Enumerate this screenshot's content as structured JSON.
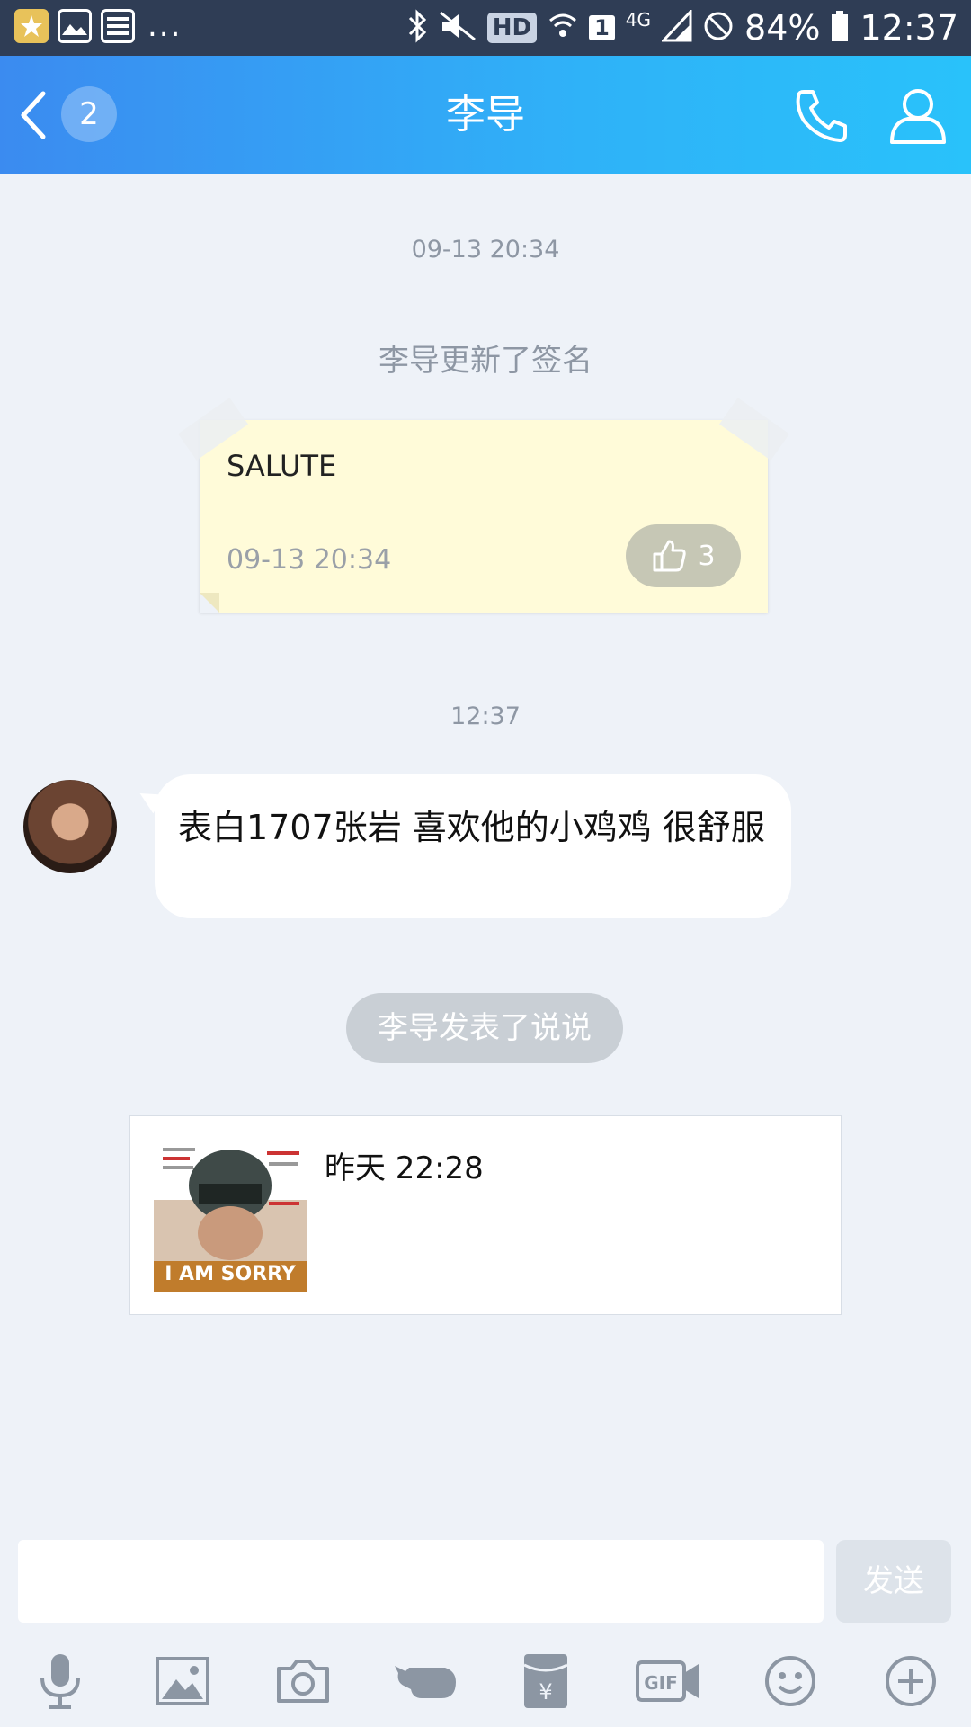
{
  "status_bar": {
    "dots": "...",
    "hd": "HD",
    "sim": "1",
    "network": "4G",
    "battery": "84%",
    "time": "12:37"
  },
  "header": {
    "title": "李导",
    "unread_count": "2",
    "gradient_start": "#3b8bf0",
    "gradient_end": "#29c2fa"
  },
  "chat": {
    "timestamp_1": "09-13 20:34",
    "signature_notice": "李导更新了签名",
    "signature_card": {
      "text": "SALUTE",
      "time": "09-13 20:34",
      "likes": "3"
    },
    "timestamp_2": "12:37",
    "message": {
      "text": "表白1707张岩 喜欢他的小鸡鸡 很舒服"
    },
    "post_notice": "李导发表了说说",
    "feed_card": {
      "time": "昨天 22:28",
      "thumbnail_caption": "I AM SORRY"
    }
  },
  "input_bar": {
    "value": "",
    "send_label": "发送"
  },
  "toolbar": {
    "icons": [
      "microphone-icon",
      "image-icon",
      "camera-icon",
      "poke-hand-icon",
      "red-packet-icon",
      "gif-icon",
      "emoji-icon",
      "plus-icon"
    ]
  }
}
